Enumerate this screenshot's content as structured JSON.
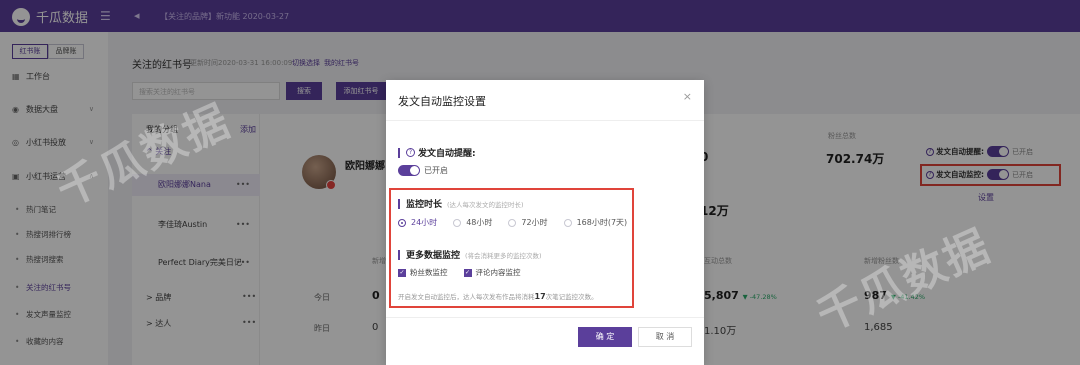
{
  "app": {
    "brand": "千瓜数据",
    "notice": "【关注的品牌】新功能  2020-03-27"
  },
  "sidebar": {
    "account_tabs": [
      "红书账",
      "品牌账"
    ],
    "items": [
      {
        "label": "工作台",
        "icon": "grid-icon"
      },
      {
        "label": "数据大盘",
        "icon": "chart-icon"
      },
      {
        "label": "小红书投放",
        "icon": "target-icon"
      },
      {
        "label": "小红书运营",
        "icon": "message-icon"
      }
    ],
    "sub_items": [
      "热门笔记",
      "热搜词排行榜",
      "热搜词搜索",
      "关注的红书号",
      "发文声量监控",
      "收藏的内容"
    ]
  },
  "main": {
    "title": "关注的红书号",
    "update_time": "更新时间2020-03-31 16:00:09",
    "link_manage": "切换选择",
    "link_my": "我的红书号",
    "search_placeholder": "搜索关注的红书号",
    "search_button": "搜索",
    "add_button": "添加红书号",
    "groups_title": "我的分组",
    "groups_add": "添加",
    "group_default": "^ 关注",
    "group_members": [
      "欧阳娜娜Nana",
      "李佳琦Austin",
      "Perfect Diary完美日记"
    ],
    "group_brand": "> 品牌",
    "group_talent": "> 达人",
    "account_name": "欧阳娜娜",
    "stat_1": "0",
    "stat_2": "702.74万",
    "stat_2_label": "粉丝总数",
    "stat_3": "12万",
    "toggle_remind_label": "发文自动提醒:",
    "toggle_monitor_label": "发文自动监控:",
    "toggle_state": "已开启",
    "settings_link": "设置",
    "row_today": "今日",
    "row_yesterday": "昨日",
    "today_left": "0",
    "today_mid": "5,807",
    "today_mid_trend": "▼ -47.28%",
    "today_right": "987",
    "today_right_trend": "▼ -41.42%",
    "yesterday_left": "0",
    "yesterday_mid": "1.10万",
    "yesterday_right": "1,685",
    "col_new": "新增",
    "col_interact": "互动总数",
    "col_fans": "新增粉丝数"
  },
  "watermark": "千瓜数据",
  "modal": {
    "title": "发文自动监控设置",
    "close": "×",
    "remind_title": "发文自动提醒:",
    "remind_state": "已开启",
    "duration_title": "监控时长",
    "duration_hint": "(达人每次发文的监控时长)",
    "duration_options": [
      "24小时",
      "48小时",
      "72小时",
      "168小时(7天)"
    ],
    "selected_duration": "24小时",
    "more_title": "更多数据监控",
    "more_hint": "(将会消耗更多的监控次数)",
    "more_options": [
      "粉丝数监控",
      "评论内容监控"
    ],
    "note_prefix": "开启发文自动监控后，达人每次发布作品将消耗",
    "note_count": "17",
    "note_suffix": "次笔记监控次数。",
    "ok": "确 定",
    "cancel": "取 消"
  },
  "colors": {
    "brand": "#5b3f9b",
    "highlight": "#e0443a"
  }
}
